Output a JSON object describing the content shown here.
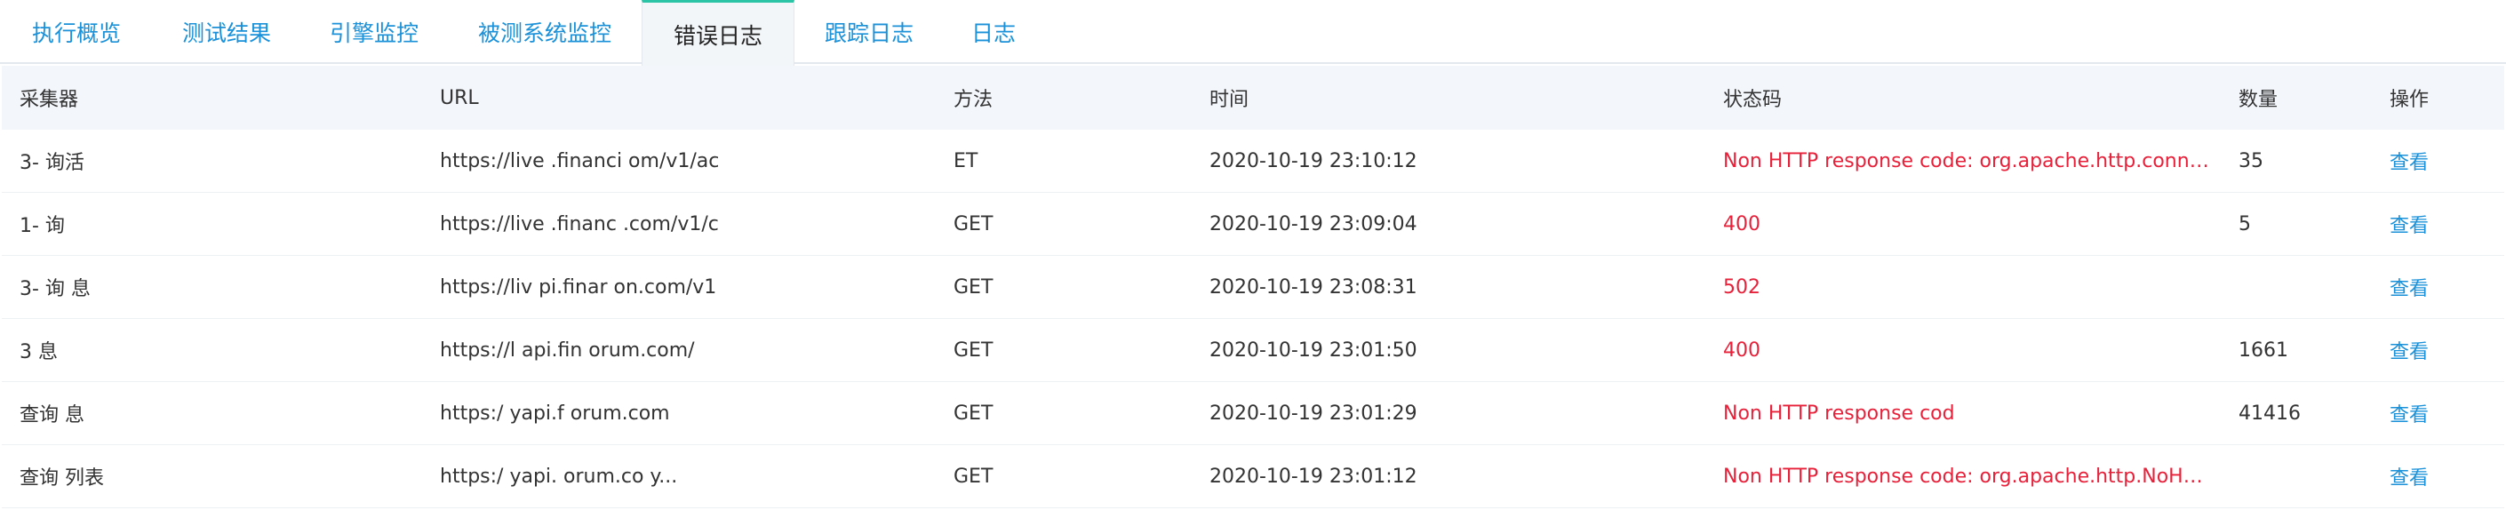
{
  "tabs": [
    {
      "label": "执行概览",
      "active": false
    },
    {
      "label": "测试结果",
      "active": false
    },
    {
      "label": "引擎监控",
      "active": false
    },
    {
      "label": "被测系统监控",
      "active": false
    },
    {
      "label": "错误日志",
      "active": true
    },
    {
      "label": "跟踪日志",
      "active": false
    },
    {
      "label": "日志",
      "active": false
    }
  ],
  "table": {
    "columns": {
      "collector": "采集器",
      "url": "URL",
      "method": "方法",
      "time": "时间",
      "status": "状态码",
      "count": "数量",
      "op": "操作"
    },
    "rows": [
      {
        "collector": "3-  询活",
        "url": "https://live .financi om/v1/ac",
        "method": "ET",
        "time": "2020-10-19 23:10:12",
        "status": "Non HTTP response code: org.apache.http.conn.Co...",
        "count": "35",
        "op": "查看"
      },
      {
        "collector": "1-  询",
        "url": "https://live .financ .com/v1/c",
        "method": "GET",
        "time": "2020-10-19 23:09:04",
        "status": "400",
        "count": "5",
        "op": "查看"
      },
      {
        "collector": "3-  询  息",
        "url": "https://liv pi.finar on.com/v1",
        "method": "GET",
        "time": "2020-10-19 23:08:31",
        "status": "502",
        "count": "",
        "op": "查看"
      },
      {
        "collector": "3  息",
        "url": "https://l api.fin orum.com/",
        "method": "GET",
        "time": "2020-10-19 23:01:50",
        "status": "400",
        "count": "1661",
        "op": "查看"
      },
      {
        "collector": "查询  息",
        "url": "https:/ yapi.f orum.com",
        "method": "GET",
        "time": "2020-10-19 23:01:29",
        "status": "Non HTTP response cod",
        "count": "41416",
        "op": "查看"
      },
      {
        "collector": "查询 列表",
        "url": "https:/ yapi. orum.co y...",
        "method": "GET",
        "time": "2020-10-19 23:01:12",
        "status": "Non HTTP response code: org.apache.http.NoHttp...",
        "count": "",
        "op": "查看"
      }
    ]
  },
  "colors": {
    "accent": "#1a91d9",
    "error": "#e8213a",
    "active_tab_border": "#2cc4a7"
  }
}
